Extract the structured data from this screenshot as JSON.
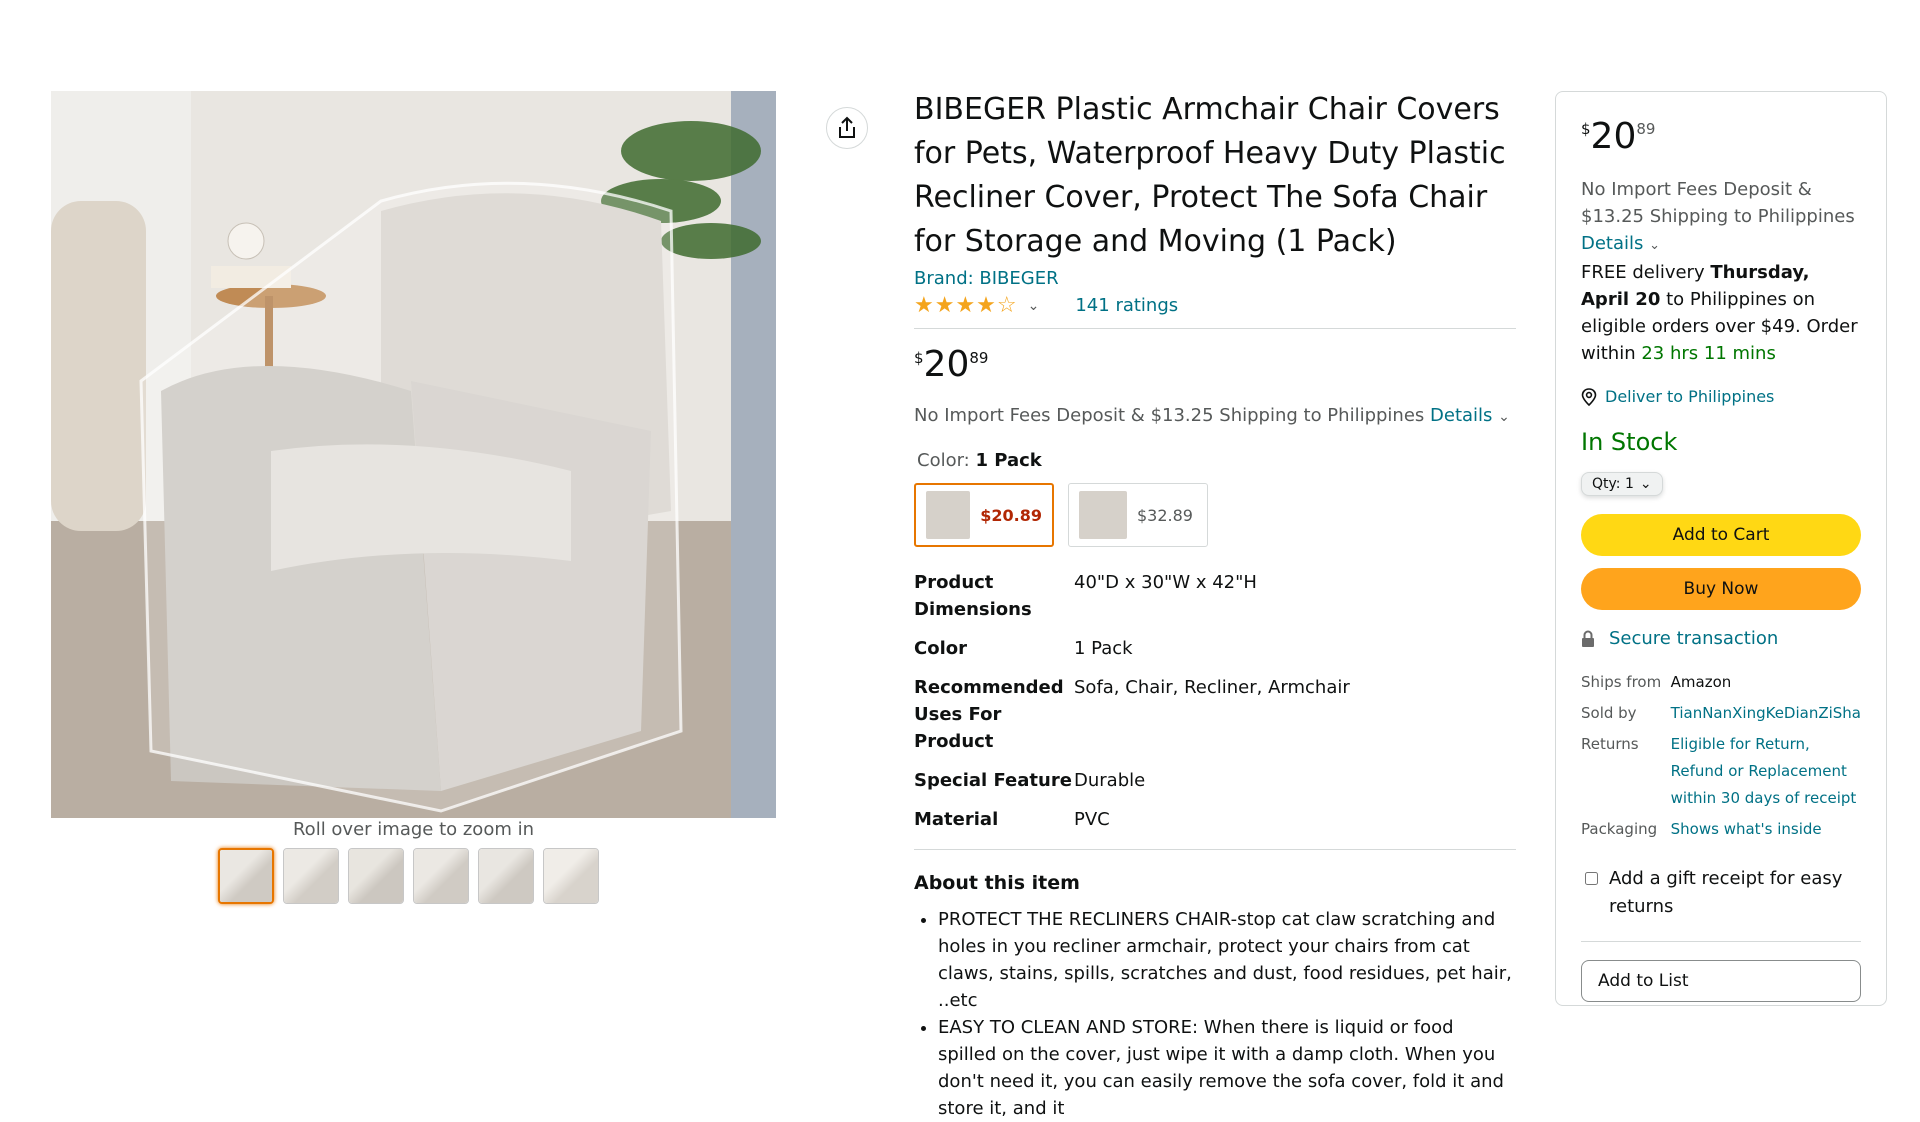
{
  "gallery": {
    "zoom_hint": "Roll over image to zoom in",
    "thumb_count": 6,
    "selected_thumb": 0
  },
  "product": {
    "title": "BIBEGER Plastic Armchair Chair Covers for Pets, Waterproof Heavy Duty Plastic Recliner Cover, Protect The Sofa Chair for Storage and Moving (1 Pack)",
    "brand": "Brand: BIBEGER",
    "rating_value": 4,
    "ratings_text": "141 ratings",
    "price": {
      "symbol": "$",
      "whole": "20",
      "fraction": "89"
    },
    "shipping_text": "No Import Fees Deposit & $13.25 Shipping to Philippines",
    "details_link": "Details",
    "color_label": "Color:",
    "color_value": "1 Pack",
    "swatches": [
      {
        "price": "$20.89",
        "selected": true
      },
      {
        "price": "$32.89",
        "selected": false
      }
    ],
    "specs": [
      {
        "k": "Product Dimensions",
        "v": "40\"D x 30\"W x 42\"H"
      },
      {
        "k": "Color",
        "v": "1 Pack"
      },
      {
        "k": "Recommended Uses For Product",
        "v": "Sofa, Chair, Recliner, Armchair"
      },
      {
        "k": "Special Feature",
        "v": "Durable"
      },
      {
        "k": "Material",
        "v": "PVC"
      }
    ],
    "about_heading": "About this item",
    "bullets": [
      "PROTECT THE RECLINERS CHAIR-stop cat claw scratching and holes in you recliner armchair, protect your chairs from cat claws, stains, spills, scratches and dust, food residues, pet hair, ..etc",
      "EASY TO CLEAN AND STORE: When there is liquid or food spilled on the cover, just wipe it with a damp cloth. When you don't need it, you can easily remove the sofa cover, fold it and store it, and it"
    ]
  },
  "buybox": {
    "price": {
      "symbol": "$",
      "whole": "20",
      "fraction": "89"
    },
    "shipping_text": "No Import Fees Deposit & $13.25 Shipping to Philippines",
    "details_link": "Details",
    "delivery_prefix": "FREE delivery",
    "delivery_date": "Thursday, April 20",
    "delivery_suffix": "to Philippines on eligible orders over $49. Order within",
    "countdown": "23 hrs 11 mins",
    "deliver_to": "Deliver to Philippines",
    "stock": "In Stock",
    "qty_label": "Qty: 1",
    "add_to_cart": "Add to Cart",
    "buy_now": "Buy Now",
    "secure": "Secure transaction",
    "ships_from_k": "Ships from",
    "ships_from_v": "Amazon",
    "sold_by_k": "Sold by",
    "sold_by_v": "TianNanXingKeDianZiSha",
    "returns_k": "Returns",
    "returns_v": "Eligible for Return, Refund or Replacement within 30 days of receipt",
    "packaging_k": "Packaging",
    "packaging_v": "Shows what's inside",
    "gift_text": "Add a gift receipt for easy returns",
    "add_to_list": "Add to List"
  },
  "colors": {
    "link": "#007185",
    "cart": "#FFD814",
    "buy": "#FFA41C",
    "green": "#007600",
    "star": "#F4A41C",
    "swatch_price": "#B12704"
  }
}
